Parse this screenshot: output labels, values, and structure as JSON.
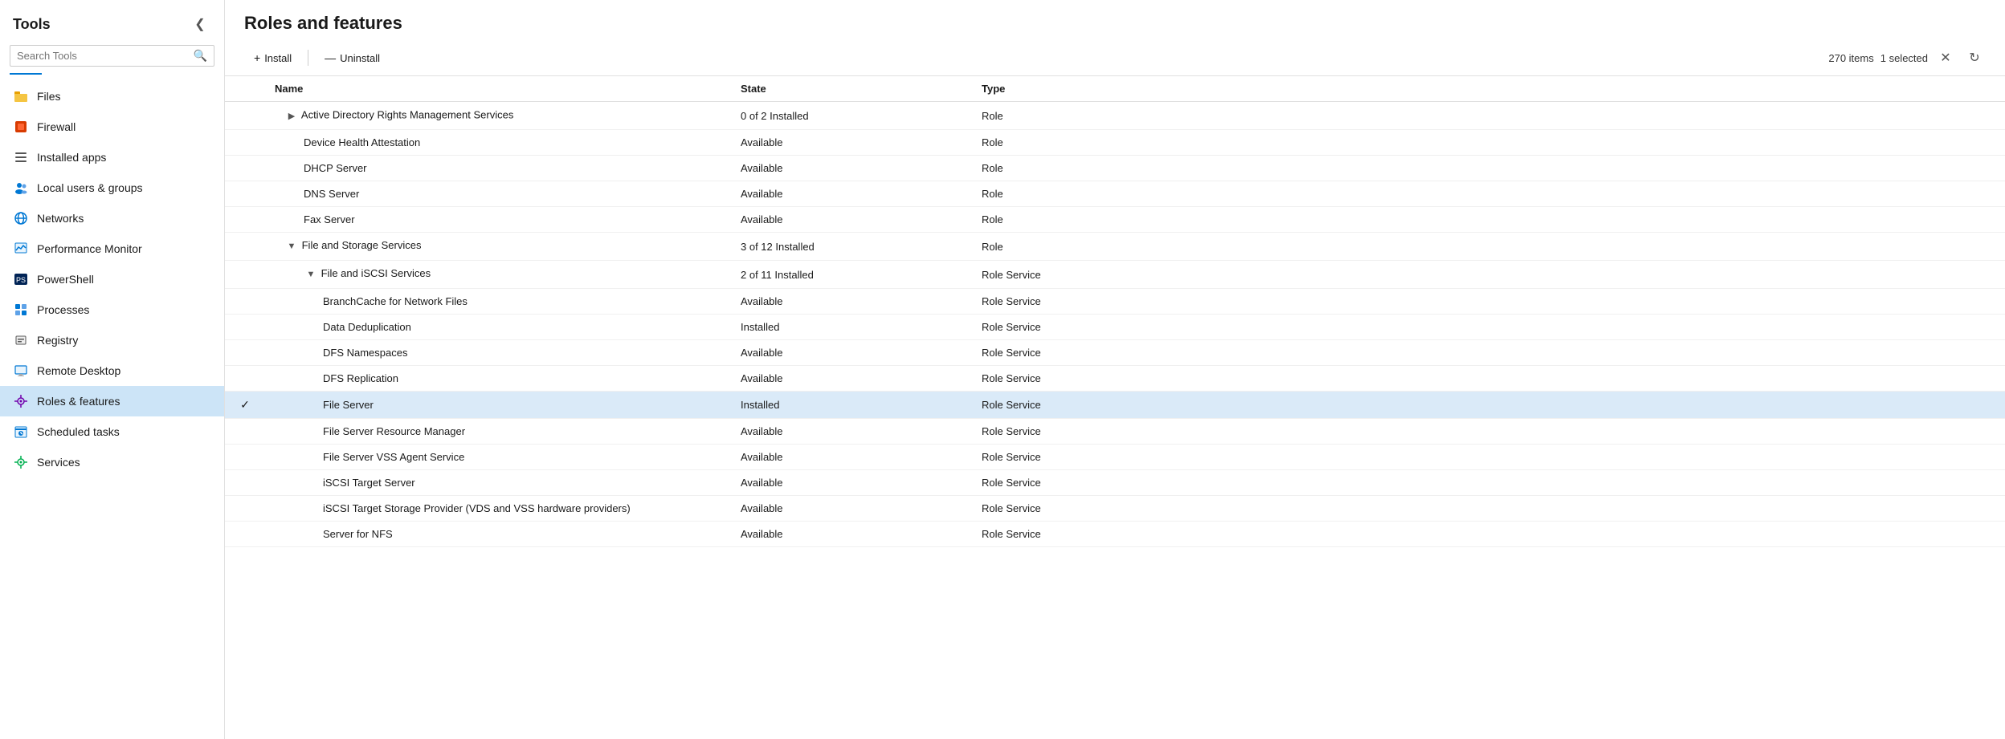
{
  "sidebar": {
    "title": "Tools",
    "search_placeholder": "Search Tools",
    "collapse_icon": "❮",
    "items": [
      {
        "id": "files",
        "label": "Files",
        "icon": "📁",
        "icon_color": "#e8a000",
        "active": false
      },
      {
        "id": "firewall",
        "label": "Firewall",
        "icon": "🔥",
        "icon_color": "#d83b01",
        "active": false
      },
      {
        "id": "installed-apps",
        "label": "Installed apps",
        "icon": "≡",
        "icon_color": "#555",
        "active": false
      },
      {
        "id": "local-users",
        "label": "Local users & groups",
        "icon": "👥",
        "icon_color": "#0078d4",
        "active": false
      },
      {
        "id": "networks",
        "label": "Networks",
        "icon": "🌐",
        "icon_color": "#0078d4",
        "active": false
      },
      {
        "id": "performance-monitor",
        "label": "Performance Monitor",
        "icon": "📊",
        "icon_color": "#0078d4",
        "active": false
      },
      {
        "id": "powershell",
        "label": "PowerShell",
        "icon": "▶",
        "icon_color": "#012456",
        "active": false
      },
      {
        "id": "processes",
        "label": "Processes",
        "icon": "⊞",
        "icon_color": "#0078d4",
        "active": false
      },
      {
        "id": "registry",
        "label": "Registry",
        "icon": "⊟",
        "icon_color": "#555",
        "active": false
      },
      {
        "id": "remote-desktop",
        "label": "Remote Desktop",
        "icon": "⊡",
        "icon_color": "#0078d4",
        "active": false
      },
      {
        "id": "roles-features",
        "label": "Roles & features",
        "icon": "⚙",
        "icon_color": "#0078d4",
        "active": true
      },
      {
        "id": "scheduled-tasks",
        "label": "Scheduled tasks",
        "icon": "🕒",
        "icon_color": "#0078d4",
        "active": false
      },
      {
        "id": "services",
        "label": "Services",
        "icon": "⚙",
        "icon_color": "#0078d4",
        "active": false
      }
    ]
  },
  "main": {
    "title": "Roles and features",
    "toolbar": {
      "install_label": "Install",
      "install_icon": "+",
      "uninstall_label": "Uninstall",
      "uninstall_icon": "—",
      "item_count": "270 items",
      "selected_count": "1 selected",
      "close_icon": "✕",
      "refresh_icon": "↻"
    },
    "table": {
      "columns": [
        "",
        "Name",
        "State",
        "Type"
      ],
      "rows": [
        {
          "indent": 1,
          "expand": "▶",
          "name": "Active Directory Rights Management Services",
          "state": "0 of 2 Installed",
          "type": "Role",
          "selected": false,
          "checked": false
        },
        {
          "indent": 2,
          "expand": "",
          "name": "Device Health Attestation",
          "state": "Available",
          "type": "Role",
          "selected": false,
          "checked": false
        },
        {
          "indent": 2,
          "expand": "",
          "name": "DHCP Server",
          "state": "Available",
          "type": "Role",
          "selected": false,
          "checked": false
        },
        {
          "indent": 2,
          "expand": "",
          "name": "DNS Server",
          "state": "Available",
          "type": "Role",
          "selected": false,
          "checked": false
        },
        {
          "indent": 2,
          "expand": "",
          "name": "Fax Server",
          "state": "Available",
          "type": "Role",
          "selected": false,
          "checked": false
        },
        {
          "indent": 1,
          "expand": "▼",
          "name": "File and Storage Services",
          "state": "3 of 12 Installed",
          "type": "Role",
          "selected": false,
          "checked": false
        },
        {
          "indent": 2,
          "expand": "▼",
          "name": "File and iSCSI Services",
          "state": "2 of 11 Installed",
          "type": "Role Service",
          "selected": false,
          "checked": false
        },
        {
          "indent": 3,
          "expand": "",
          "name": "BranchCache for Network Files",
          "state": "Available",
          "type": "Role Service",
          "selected": false,
          "checked": false
        },
        {
          "indent": 3,
          "expand": "",
          "name": "Data Deduplication",
          "state": "Installed",
          "type": "Role Service",
          "selected": false,
          "checked": false
        },
        {
          "indent": 3,
          "expand": "",
          "name": "DFS Namespaces",
          "state": "Available",
          "type": "Role Service",
          "selected": false,
          "checked": false
        },
        {
          "indent": 3,
          "expand": "",
          "name": "DFS Replication",
          "state": "Available",
          "type": "Role Service",
          "selected": false,
          "checked": false
        },
        {
          "indent": 3,
          "expand": "",
          "name": "File Server",
          "state": "Installed",
          "type": "Role Service",
          "selected": true,
          "checked": true
        },
        {
          "indent": 3,
          "expand": "",
          "name": "File Server Resource Manager",
          "state": "Available",
          "type": "Role Service",
          "selected": false,
          "checked": false
        },
        {
          "indent": 3,
          "expand": "",
          "name": "File Server VSS Agent Service",
          "state": "Available",
          "type": "Role Service",
          "selected": false,
          "checked": false
        },
        {
          "indent": 3,
          "expand": "",
          "name": "iSCSI Target Server",
          "state": "Available",
          "type": "Role Service",
          "selected": false,
          "checked": false
        },
        {
          "indent": 3,
          "expand": "",
          "name": "iSCSI Target Storage Provider (VDS and VSS hardware providers)",
          "state": "Available",
          "type": "Role Service",
          "selected": false,
          "checked": false
        },
        {
          "indent": 3,
          "expand": "",
          "name": "Server for NFS",
          "state": "Available",
          "type": "Role Service",
          "selected": false,
          "checked": false
        }
      ]
    }
  }
}
